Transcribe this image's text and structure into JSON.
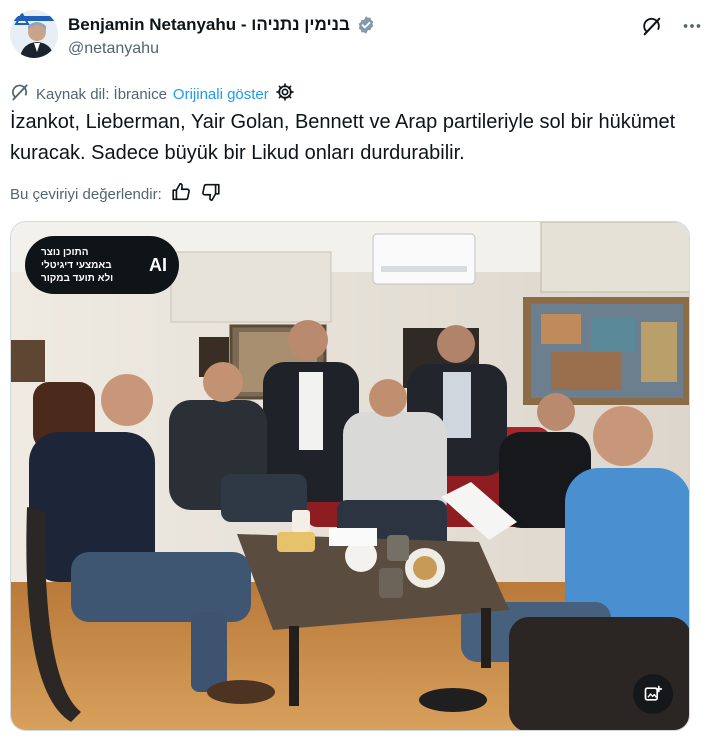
{
  "author": {
    "display_name": "Benjamin Netanyahu - בנימין נתניהו",
    "handle": "@netanyahu",
    "verified": true
  },
  "icons": {
    "grok": "grok-icon",
    "more": "more-icon",
    "translate": "translate-icon",
    "settings": "settings-gear-icon",
    "thumbs_up": "thumbs-up-icon",
    "thumbs_down": "thumbs-down-icon",
    "media_action": "image-action-icon"
  },
  "translation": {
    "source_label": "Kaynak dil: İbranice",
    "show_original": "Orijinali göster"
  },
  "tweet": {
    "text": "İzankot, Lieberman, Yair Golan, Bennett ve Arap partileriyle sol bir hükümet kuracak. Sadece büyük bir Likud onları durdurabilir."
  },
  "rating": {
    "label": "Bu çeviriyi değerlendir:"
  },
  "media": {
    "ai_badge": {
      "lines": [
        "התוכן נוצר",
        "באמצעי דיגיטלי",
        "ולא תועד במקור"
      ],
      "mark": "AI"
    }
  },
  "colors": {
    "accent": "#1d9bf0",
    "text": "#0f1419",
    "muted": "#536471",
    "border": "#cfd9de"
  }
}
